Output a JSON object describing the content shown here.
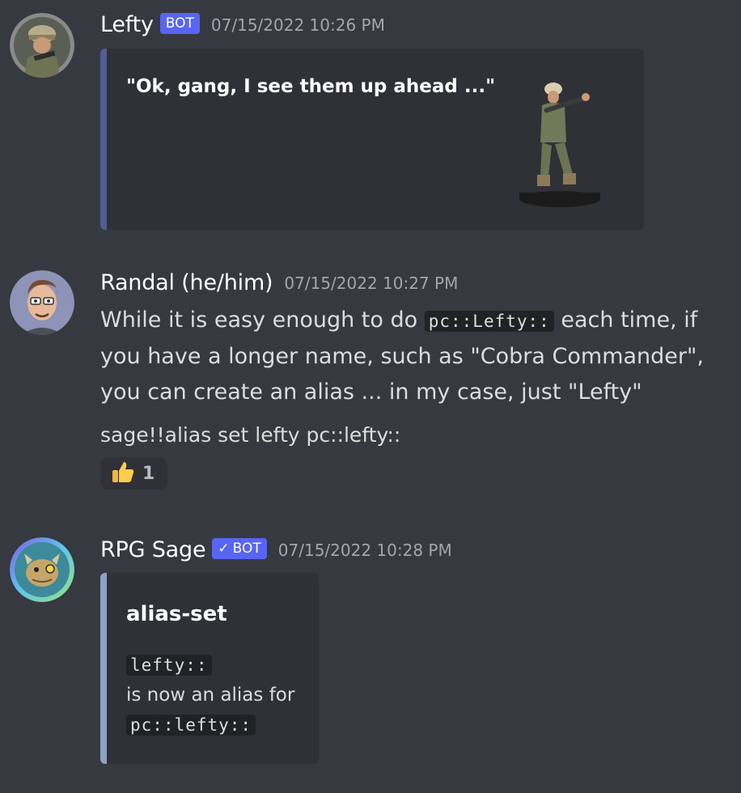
{
  "messages": [
    {
      "author": "Lefty",
      "bot_tag": "BOT",
      "timestamp": "07/15/2022 10:26 PM",
      "embed_quote": "\"Ok, gang, I see them up ahead ...\""
    },
    {
      "author": "Randal (he/him)",
      "timestamp": "07/15/2022 10:27 PM",
      "text_before_code": "While it is easy enough to do ",
      "inline_code": "pc::Lefty::",
      "text_after_code": " each time, if you have a longer name, such as \"Cobra Commander\", you can create an alias ... in my case, just \"Lefty\"",
      "command_line": "sage!!alias set lefty pc::lefty::",
      "reaction": {
        "emoji": "thumbs-up",
        "count": "1"
      }
    },
    {
      "author": "RPG Sage",
      "bot_tag": "BOT",
      "verified_check": "✓",
      "timestamp": "07/15/2022 10:28 PM",
      "embed_title": "alias-set",
      "embed_code_1": "lefty::",
      "embed_text": "is now an alias for",
      "embed_code_2": "pc::lefty::"
    }
  ],
  "colors": {
    "background": "#36393f",
    "embed_background": "#2f3136",
    "bot_tag": "#5865f2",
    "embed_bar_lefty": "#4f5d95",
    "embed_bar_sage": "#8ea2bf"
  }
}
